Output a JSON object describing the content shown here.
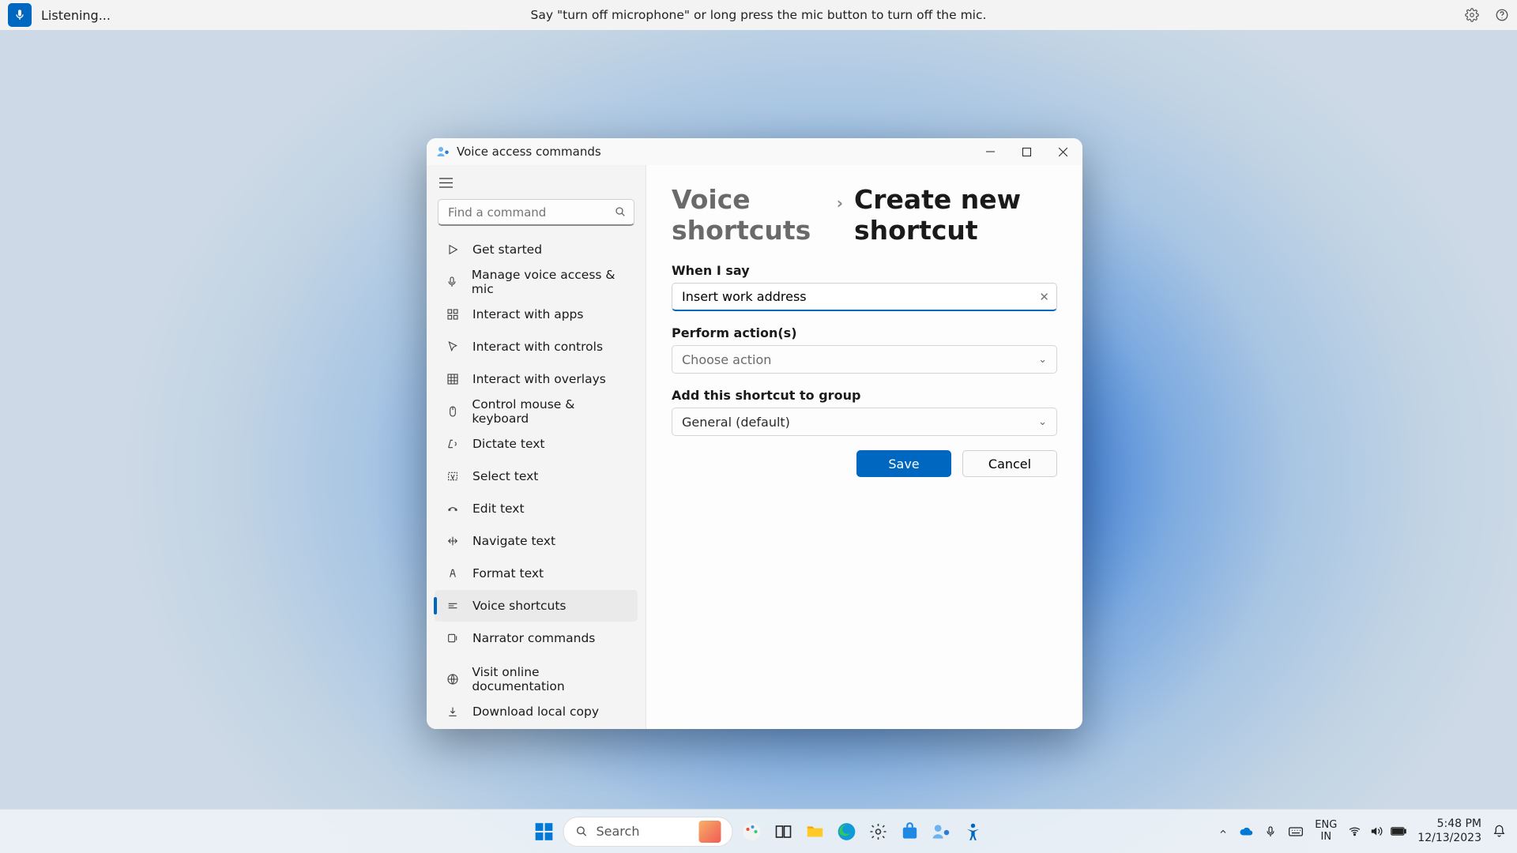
{
  "voicebar": {
    "status": "Listening...",
    "hint": "Say \"turn off microphone\" or long press the mic button to turn off the mic."
  },
  "window": {
    "title": "Voice access commands"
  },
  "sidebar": {
    "search_placeholder": "Find a command",
    "items": [
      {
        "label": "Get started"
      },
      {
        "label": "Manage voice access & mic"
      },
      {
        "label": "Interact with apps"
      },
      {
        "label": "Interact with controls"
      },
      {
        "label": "Interact with overlays"
      },
      {
        "label": "Control mouse & keyboard"
      },
      {
        "label": "Dictate text"
      },
      {
        "label": "Select text"
      },
      {
        "label": "Edit text"
      },
      {
        "label": "Navigate text"
      },
      {
        "label": "Format text"
      },
      {
        "label": "Voice shortcuts"
      },
      {
        "label": "Narrator commands"
      }
    ],
    "footer": [
      {
        "label": "Visit online documentation"
      },
      {
        "label": "Download local copy"
      }
    ],
    "selected_index": 11
  },
  "main": {
    "breadcrumb_root": "Voice shortcuts",
    "breadcrumb_leaf": "Create new shortcut",
    "label_when": "When I say",
    "input_value": "Insert work address",
    "label_actions": "Perform action(s)",
    "action_placeholder": "Choose action",
    "label_group": "Add this shortcut to group",
    "group_value": "General (default)",
    "save": "Save",
    "cancel": "Cancel"
  },
  "taskbar": {
    "search_placeholder": "Search",
    "language_top": "ENG",
    "language_bottom": "IN",
    "time": "5:48 PM",
    "date": "12/13/2023"
  }
}
